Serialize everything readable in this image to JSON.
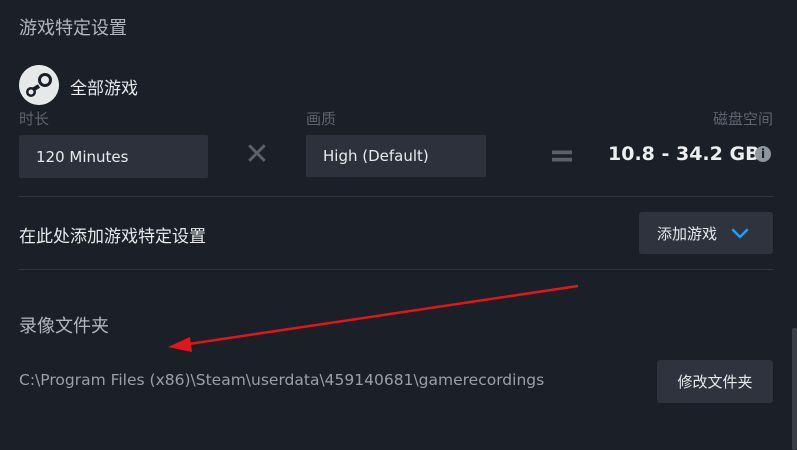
{
  "section_title": "游戏特定设置",
  "game": {
    "name": "全部游戏",
    "icon": "steam-logo-icon"
  },
  "labels": {
    "duration": "时长",
    "quality": "画质",
    "disk_space": "磁盘空间"
  },
  "duration": {
    "value": "120 Minutes"
  },
  "quality": {
    "value": "High (Default)"
  },
  "operators": {
    "times": "✕",
    "equals": "="
  },
  "disk_space": {
    "value": "10.8 - 34.2 GB",
    "info_icon": "i"
  },
  "add_setting": {
    "text": "在此处添加游戏特定设置",
    "button_label": "添加游戏"
  },
  "recording": {
    "title": "录像文件夹",
    "path": "C:\\Program Files (x86)\\Steam\\userdata\\459140681\\gamerecordings",
    "change_button": "修改文件夹"
  },
  "colors": {
    "accent": "#1a9fff",
    "arrow": "#e0161b",
    "background": "#1b1f27"
  }
}
